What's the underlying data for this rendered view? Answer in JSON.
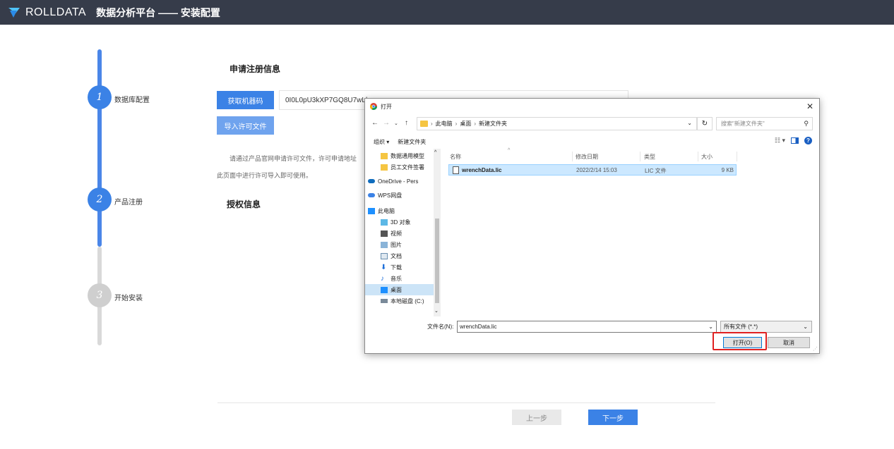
{
  "app": {
    "brand": "ROLLDATA",
    "title": "数据分析平台 —— 安装配置"
  },
  "colors": {
    "topbar": "#363c4a",
    "primary": "#3b82e6",
    "step_inactive": "#cfcfcf",
    "highlight": "#e02020"
  },
  "steps": [
    {
      "num": "1",
      "label": "数据库配置",
      "state": "done"
    },
    {
      "num": "2",
      "label": "产品注册",
      "state": "active"
    },
    {
      "num": "3",
      "label": "开始安装",
      "state": "pending"
    }
  ],
  "registration": {
    "section_title": "申请注册信息",
    "get_code_button": "获取机器码",
    "machine_code": "0I0L0pU3kXP7GQ8U7wLb",
    "import_button": "导入许可文件",
    "hint_line1": "请通过产品官网申请许可文件，许可申请地址",
    "hint_line2": "此页面中进行许可导入即可使用。",
    "auth_title": "授权信息"
  },
  "footer": {
    "prev_button": "上一步",
    "next_button": "下一步"
  },
  "dialog": {
    "title": "打开",
    "breadcrumb": [
      "此电脑",
      "桌面",
      "新建文件夹"
    ],
    "search_placeholder": "搜索\"新建文件夹\"",
    "toolbar": {
      "organize": "组织 ▾",
      "new_folder": "新建文件夹"
    },
    "nav_items": [
      {
        "label": "数据通用模型",
        "icon": "folder-icon"
      },
      {
        "label": "员工文件签署",
        "icon": "folder-icon"
      },
      {
        "label": "OneDrive - Pers",
        "icon": "cloud-icon"
      },
      {
        "label": "WPS网盘",
        "icon": "cloud-icon"
      },
      {
        "label": "此电脑",
        "icon": "computer-icon"
      },
      {
        "label": "3D 对象",
        "icon": "cube-icon"
      },
      {
        "label": "视频",
        "icon": "video-icon"
      },
      {
        "label": "图片",
        "icon": "picture-icon"
      },
      {
        "label": "文档",
        "icon": "document-icon"
      },
      {
        "label": "下载",
        "icon": "download-icon"
      },
      {
        "label": "音乐",
        "icon": "music-icon"
      },
      {
        "label": "桌面",
        "icon": "desktop-icon"
      },
      {
        "label": "本地磁盘 (C:)",
        "icon": "drive-icon"
      }
    ],
    "columns": {
      "name": "名称",
      "date": "修改日期",
      "type": "类型",
      "size": "大小"
    },
    "files": [
      {
        "name": "wrenchData.lic",
        "date": "2022/2/14 15:03",
        "type": "LIC 文件",
        "size": "9 KB"
      }
    ],
    "filename_label": "文件名(N):",
    "filename_value": "wrenchData.lic",
    "filetype_value": "所有文件 (*.*)",
    "open_button": "打开(O)",
    "cancel_button": "取消"
  }
}
